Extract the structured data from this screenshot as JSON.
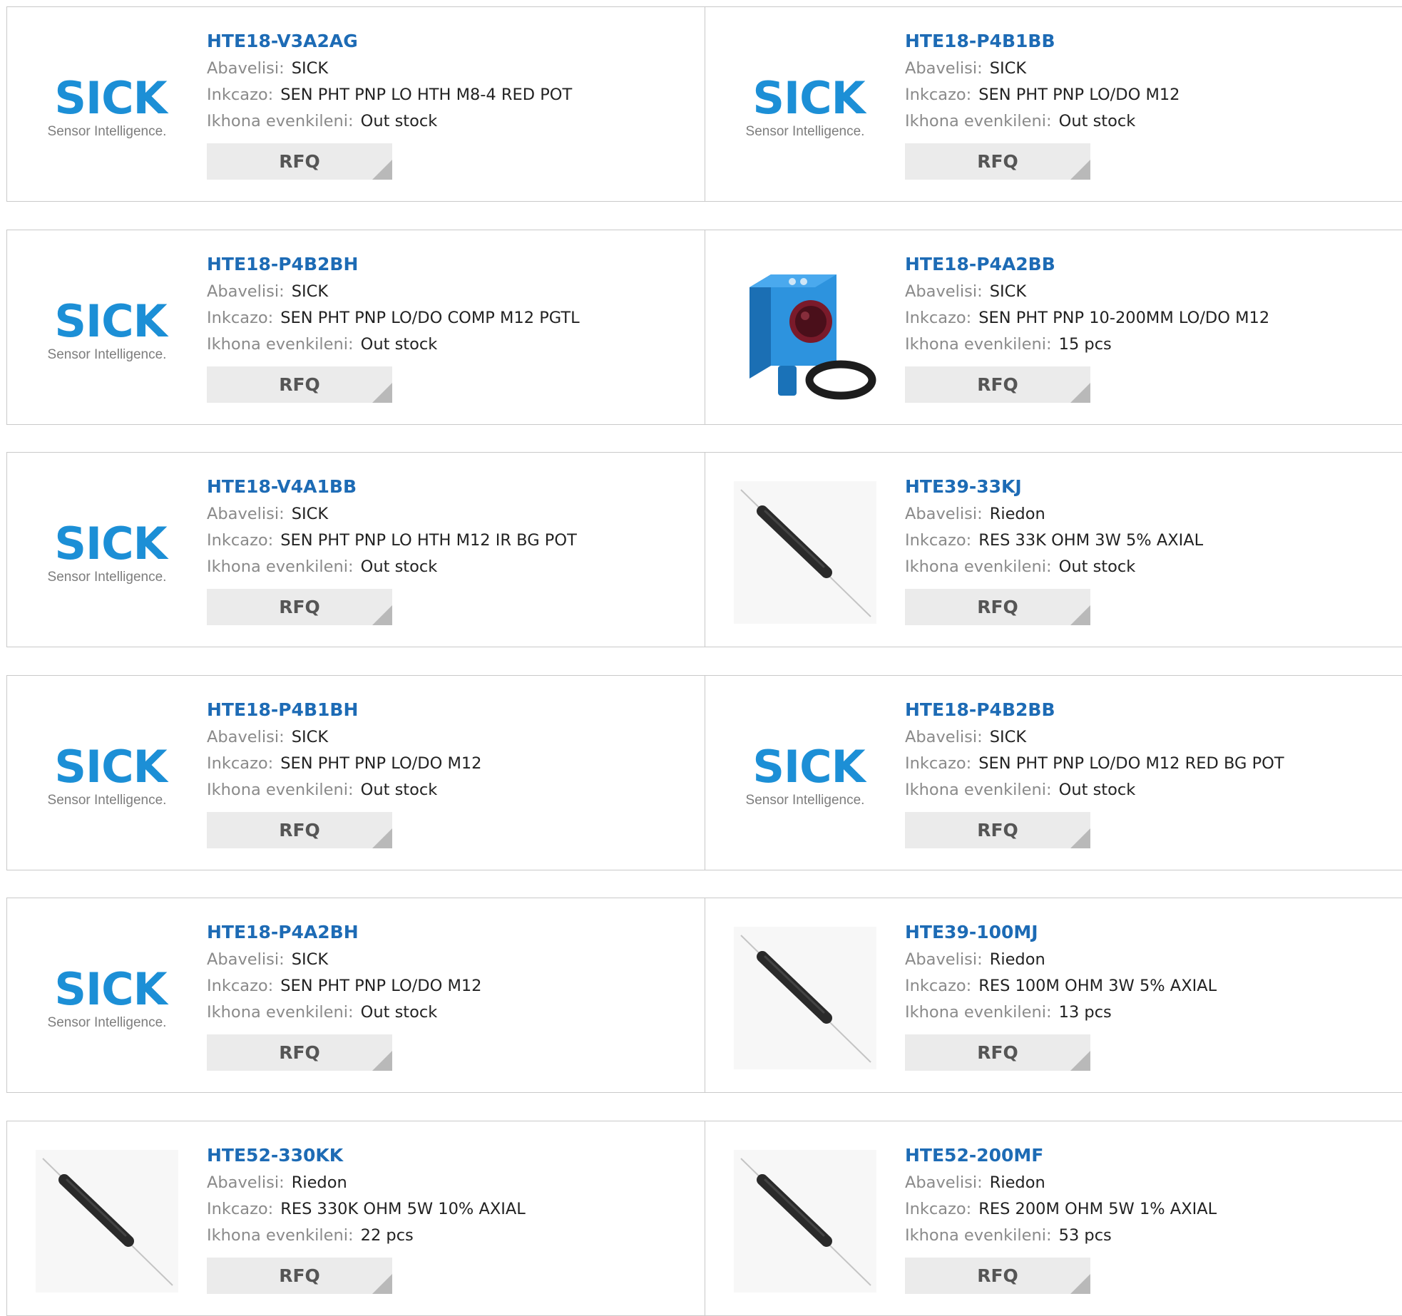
{
  "labels": {
    "manufacturer": "Abavelisi:",
    "description": "Inkcazo:",
    "stock": "Ikhona evenkileni:",
    "rfq": "RFQ"
  },
  "logo": {
    "word": "SICK",
    "tagline": "Sensor Intelligence."
  },
  "colors": {
    "part_link": "#1d6bb5",
    "sick_blue": "#1c8fd6",
    "label_gray": "#8a8a8a",
    "button_bg": "#ebebeb"
  },
  "products": [
    {
      "part": "HTE18-V3A2AG",
      "manufacturer": "SICK",
      "description": "SEN PHT PNP LO HTH M8-4 RED POT",
      "stock": "Out stock",
      "image": "sick-logo"
    },
    {
      "part": "HTE18-P4B1BB",
      "manufacturer": "SICK",
      "description": "SEN PHT PNP LO/DO M12",
      "stock": "Out stock",
      "image": "sick-logo"
    },
    {
      "part": "HTE18-P4B2BH",
      "manufacturer": "SICK",
      "description": "SEN PHT PNP LO/DO COMP M12 PGTL",
      "stock": "Out stock",
      "image": "sick-logo"
    },
    {
      "part": "HTE18-P4A2BB",
      "manufacturer": "SICK",
      "description": "SEN PHT PNP 10-200MM LO/DO M12",
      "stock": "15 pcs",
      "image": "photoelectric-sensor"
    },
    {
      "part": "HTE18-V4A1BB",
      "manufacturer": "SICK",
      "description": "SEN PHT PNP LO HTH M12 IR BG POT",
      "stock": "Out stock",
      "image": "sick-logo"
    },
    {
      "part": "HTE39-33KJ",
      "manufacturer": "Riedon",
      "description": "RES 33K OHM 3W 5% AXIAL",
      "stock": "Out stock",
      "image": "axial-resistor"
    },
    {
      "part": "HTE18-P4B1BH",
      "manufacturer": "SICK",
      "description": "SEN PHT PNP LO/DO M12",
      "stock": "Out stock",
      "image": "sick-logo"
    },
    {
      "part": "HTE18-P4B2BB",
      "manufacturer": "SICK",
      "description": "SEN PHT PNP LO/DO M12 RED BG POT",
      "stock": "Out stock",
      "image": "sick-logo"
    },
    {
      "part": "HTE18-P4A2BH",
      "manufacturer": "SICK",
      "description": "SEN PHT PNP LO/DO M12",
      "stock": "Out stock",
      "image": "sick-logo"
    },
    {
      "part": "HTE39-100MJ",
      "manufacturer": "Riedon",
      "description": "RES 100M OHM 3W 5% AXIAL",
      "stock": "13 pcs",
      "image": "axial-resistor"
    },
    {
      "part": "HTE52-330KK",
      "manufacturer": "Riedon",
      "description": "RES 330K OHM 5W 10% AXIAL",
      "stock": "22 pcs",
      "image": "axial-resistor"
    },
    {
      "part": "HTE52-200MF",
      "manufacturer": "Riedon",
      "description": "RES 200M OHM 5W 1% AXIAL",
      "stock": "53 pcs",
      "image": "axial-resistor"
    }
  ]
}
